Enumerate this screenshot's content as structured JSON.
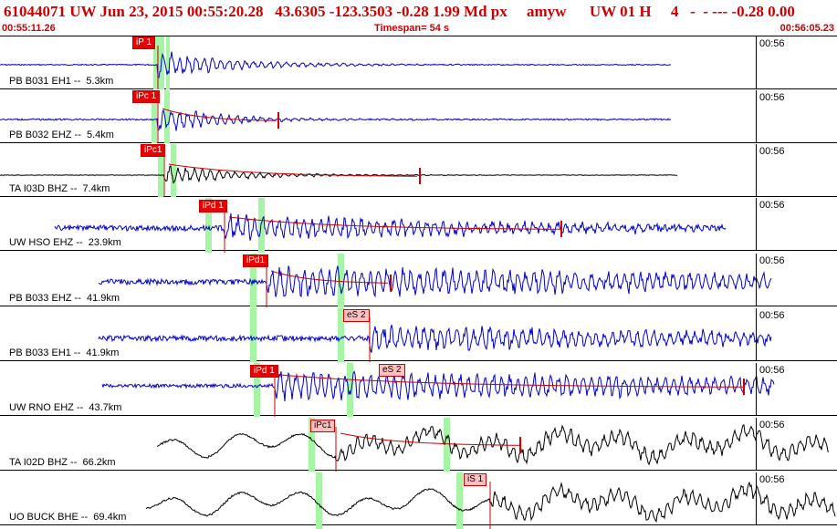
{
  "header": {
    "title": "61044071 UW Jun 23, 2015 00:55:20.28   43.6305 -123.3503 -0.28 1.99 Md px     amyw      UW 01 H     4   -  - --- -0.28 0.00",
    "start_time": "00:55:11.26",
    "timespan": "Timespan=  54 s",
    "end_time": "00:56:05.23"
  },
  "colors": {
    "header_text": "#cc0000",
    "trace_blue": "#0000cc",
    "trace_black": "#000000",
    "pick_band": "#a6f5a6",
    "coda_red": "#cc0000"
  },
  "panels": [
    {
      "label": "PB B031 EH1 --  5.3km",
      "tick": "00:56",
      "pick": "iP 1",
      "pick_style": "strong",
      "color": "blue"
    },
    {
      "label": "PB B032 EHZ --  5.4km",
      "tick": "00:56",
      "pick": "iPc 1",
      "pick_style": "strong",
      "color": "blue"
    },
    {
      "label": "TA I03D BHZ --  7.4km",
      "tick": "00:56",
      "pick": "iPc1",
      "pick_style": "strong",
      "color": "black"
    },
    {
      "label": "UW HSO EHZ --  23.9km",
      "tick": "00:56",
      "pick": "iPd 1",
      "pick_style": "strong",
      "color": "blue"
    },
    {
      "label": "PB B033 EHZ --  41.9km",
      "tick": "00:56",
      "pick": "iPd1",
      "pick_style": "strong",
      "color": "blue"
    },
    {
      "label": "PB B033 EH1 --  41.9km",
      "tick": "00:56",
      "pick": "eS 2",
      "pick_style": "weak",
      "color": "blue"
    },
    {
      "label": "UW RNO EHZ --  43.7km",
      "tick": "00:56",
      "pick": "iPd 1",
      "pick2": "eS 2",
      "pick_style": "strong",
      "color": "blue"
    },
    {
      "label": "TA I02D BHZ --  66.2km",
      "tick": "00:56",
      "pick": "iPc1",
      "pick_style": "weak",
      "color": "black"
    },
    {
      "label": "UO BUCK BHE --  69.4km",
      "tick": "00:56",
      "pick": "iS 1",
      "pick_style": "weak",
      "color": "black"
    }
  ]
}
